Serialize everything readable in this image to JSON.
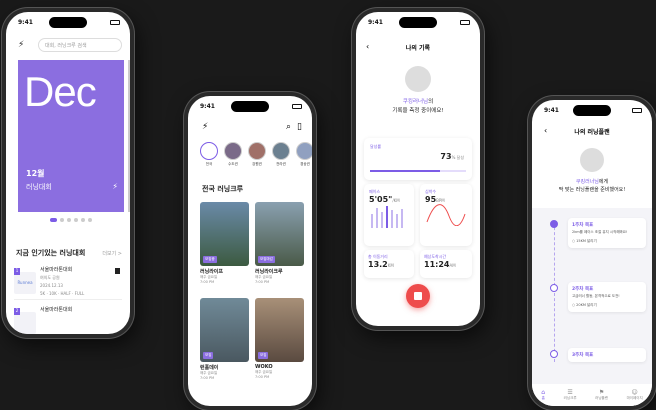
{
  "status": {
    "time": "9:41"
  },
  "phone1": {
    "search_placeholder": "대회, 러닝크루 검색",
    "card_title": "Dec",
    "card_month": "12월",
    "card_event": "러닝대회",
    "section_title": "지금 인기있는 러닝대회",
    "section_more": "더보기 >",
    "items": [
      {
        "rank": "1",
        "thumb_label": "Runnea",
        "title": "서울마라톤대회",
        "location": "여의도 공원",
        "date": "2024.12.13",
        "course": "5K · 10K · HALF · FULL"
      },
      {
        "rank": "2",
        "thumb_label": "",
        "title": "서울마라톤대회",
        "location": "",
        "date": "",
        "course": ""
      }
    ]
  },
  "phone2": {
    "stories": [
      {
        "label": "전국"
      },
      {
        "label": "수도권"
      },
      {
        "label": "강원권"
      },
      {
        "label": "전라권"
      },
      {
        "label": "경상권"
      }
    ],
    "section_title": "전국 러닝크루",
    "crews": [
      {
        "name": "러닝라이프",
        "sub1": "매주 금요일",
        "sub2": "7:00 PM",
        "tag": "모집중"
      },
      {
        "name": "러닝라이크루",
        "sub1": "매주 금요일",
        "sub2": "7:00 PM",
        "tag": "모집마감"
      },
      {
        "name": "런홀데이",
        "sub1": "매주 금요일",
        "sub2": "7:00 PM",
        "tag": "모집"
      },
      {
        "name": "WOKO",
        "sub1": "매주 금요일",
        "sub2": "7:00 PM",
        "tag": "모집"
      }
    ]
  },
  "phone3": {
    "title": "나의 기록",
    "msg_name": "쿠킹러너님",
    "msg_line1_suffix": "의",
    "msg_line2": "기록을 측정 중이에요!",
    "achievement_label": "달성률",
    "achievement_value": "73",
    "achievement_unit": "% 달성",
    "achievement_fraction": 0.73,
    "pace_label": "페이스",
    "pace_value": "5'05\"",
    "pace_unit": "/KM",
    "heart_label": "심박수",
    "heart_value": "95",
    "heart_unit": "BPM",
    "distance_label": "총 이동거리",
    "distance_value": "13.2",
    "distance_unit": "KM",
    "time_label": "예상도착시간",
    "time_value": "11:24",
    "time_unit": "AM"
  },
  "phone4": {
    "title": "나의 러닝플랜",
    "msg_name": "쿠킹러너님",
    "msg_line1_suffix": "에게",
    "msg_line2": "딱 맞는 러닝플랜을 준비했어요!",
    "plans": [
      {
        "week": "1주차 목표",
        "desc": "2km를 페이스 조절 유지 시작해봐요!",
        "check": "15KM 달리기"
      },
      {
        "week": "2주차 목표",
        "desc": "고급러너 활동, 본격적으로 도전!",
        "check": "20KM 달리기"
      },
      {
        "week": "3주차 목표",
        "desc": "",
        "check": ""
      }
    ],
    "tabs": [
      {
        "label": "홈",
        "icon": "home-icon"
      },
      {
        "label": "러닝크루",
        "icon": "group-icon"
      },
      {
        "label": "러닝플랜",
        "icon": "flag-icon"
      },
      {
        "label": "마이페이지",
        "icon": "user-icon"
      }
    ]
  },
  "colors": {
    "accent": "#7c5ce6",
    "stop": "#ee4c4c"
  }
}
